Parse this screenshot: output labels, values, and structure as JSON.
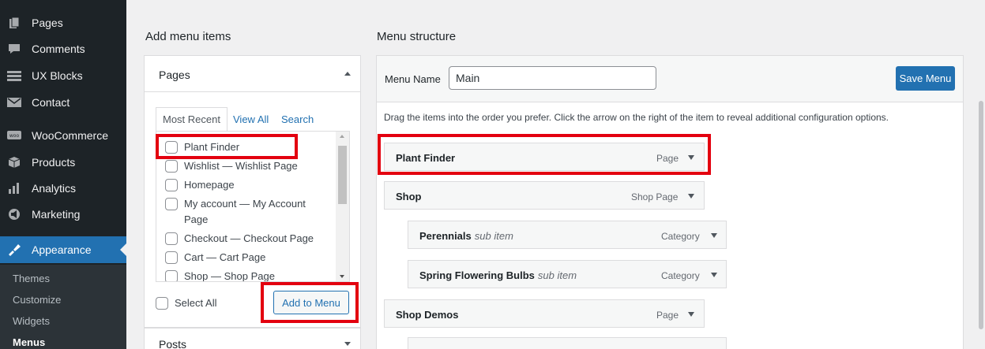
{
  "sidebar": {
    "items": [
      {
        "label": "Pages",
        "icon": "pages-icon"
      },
      {
        "label": "Comments",
        "icon": "comments-icon"
      },
      {
        "label": "UX Blocks",
        "icon": "ux-blocks-icon"
      },
      {
        "label": "Contact",
        "icon": "contact-icon"
      },
      {
        "label": "WooCommerce",
        "icon": "woocommerce-icon"
      },
      {
        "label": "Products",
        "icon": "products-icon"
      },
      {
        "label": "Analytics",
        "icon": "analytics-icon"
      },
      {
        "label": "Marketing",
        "icon": "marketing-icon"
      },
      {
        "label": "Appearance",
        "icon": "appearance-icon"
      }
    ],
    "submenu": [
      "Themes",
      "Customize",
      "Widgets",
      "Menus"
    ],
    "active_item": "Appearance",
    "current_submenu": "Menus",
    "colors": {
      "bg": "#1d2327",
      "active": "#2271b1",
      "submenu_bg": "#2c3338"
    }
  },
  "add_items": {
    "heading": "Add menu items",
    "pages_section": {
      "title": "Pages",
      "tabs": [
        "Most Recent",
        "View All",
        "Search"
      ],
      "active_tab": "Most Recent",
      "items": [
        {
          "label": "Plant Finder",
          "suffix": ""
        },
        {
          "label": "Wishlist",
          "suffix": " — Wishlist Page"
        },
        {
          "label": "Homepage",
          "suffix": ""
        },
        {
          "label": "My account",
          "suffix": " — My Account Page"
        },
        {
          "label": "Checkout",
          "suffix": " — Checkout Page"
        },
        {
          "label": "Cart",
          "suffix": " — Cart Page"
        },
        {
          "label": "Shop",
          "suffix": " — Shop Page"
        }
      ],
      "select_all": "Select All",
      "add_button": "Add to Menu"
    },
    "posts_section": {
      "title": "Posts"
    }
  },
  "menu_structure": {
    "heading": "Menu structure",
    "menu_name_label": "Menu Name",
    "menu_name_value": "Main",
    "save_button": "Save Menu",
    "instructions": "Drag the items into the order you prefer. Click the arrow on the right of the item to reveal additional configuration options.",
    "items": [
      {
        "title": "Plant Finder",
        "sub": "",
        "type": "Page"
      },
      {
        "title": "Shop",
        "sub": "",
        "type": "Shop Page"
      },
      {
        "title": "Perennials",
        "sub": "sub item",
        "type": "Category"
      },
      {
        "title": "Spring Flowering Bulbs",
        "sub": "sub item",
        "type": "Category"
      },
      {
        "title": "Shop Demos",
        "sub": "",
        "type": "Page"
      }
    ]
  },
  "highlight_color": "#e3000f"
}
